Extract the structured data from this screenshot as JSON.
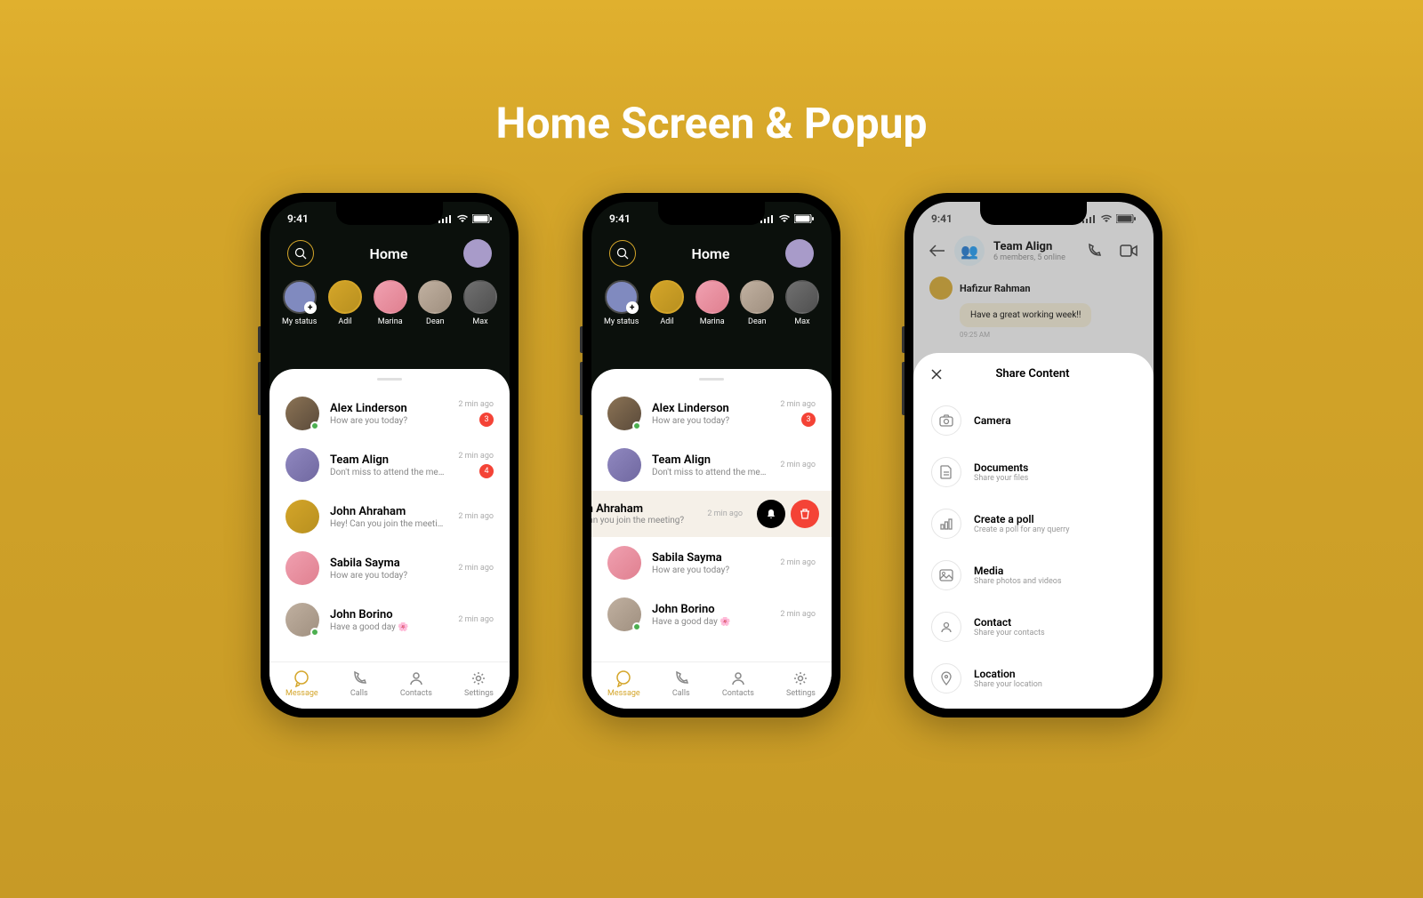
{
  "page": {
    "title": "Home Screen & Popup"
  },
  "status": {
    "time": "9:41"
  },
  "header": {
    "title": "Home"
  },
  "stories": [
    {
      "name": "My status"
    },
    {
      "name": "Adil"
    },
    {
      "name": "Marina"
    },
    {
      "name": "Dean"
    },
    {
      "name": "Max"
    }
  ],
  "chats": [
    {
      "name": "Alex Linderson",
      "msg": "How are you today?",
      "time": "2 min ago",
      "badge": "3"
    },
    {
      "name": "Team Align",
      "msg": "Don't miss to attend the meeting.",
      "time": "2 min ago",
      "badge": "4"
    },
    {
      "name": "John Ahraham",
      "msg": "Hey! Can you join the meeting?",
      "time": "2 min ago"
    },
    {
      "name": "Sabila Sayma",
      "msg": "How are you today?",
      "time": "2 min ago"
    },
    {
      "name": "John Borino",
      "msg": "Have a good day 🌸",
      "time": "2 min ago"
    }
  ],
  "swipe": {
    "name": "ohn Ahraham",
    "msg": "y! Can you join the meeting?",
    "time": "2 min ago"
  },
  "nav": [
    {
      "label": "Message"
    },
    {
      "label": "Calls"
    },
    {
      "label": "Contacts"
    },
    {
      "label": "Settings"
    }
  ],
  "groupChat": {
    "name": "Team Align",
    "sub": "6 members, 5 online",
    "sender": "Hafizur Rahman",
    "bubble": "Have a great working week!!",
    "time": "09:25 AM"
  },
  "sheet": {
    "title": "Share Content",
    "items": [
      {
        "name": "Camera",
        "sub": ""
      },
      {
        "name": "Documents",
        "sub": "Share your files"
      },
      {
        "name": "Create a poll",
        "sub": "Create a poll for any querry"
      },
      {
        "name": "Media",
        "sub": "Share photos and videos"
      },
      {
        "name": "Contact",
        "sub": "Share your contacts"
      },
      {
        "name": "Location",
        "sub": "Share your location"
      }
    ]
  }
}
